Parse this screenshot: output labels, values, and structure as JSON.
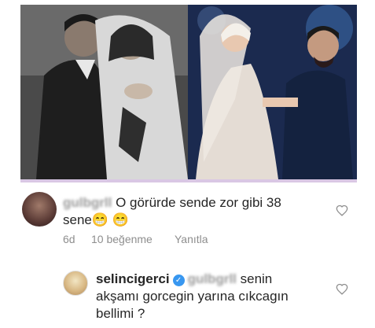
{
  "comment1": {
    "username": "gulbgrll",
    "text_line1": "O görürde sende zor gibi  38",
    "text_line2_prefix": "sene",
    "emoji1": "😁",
    "emoji2": "😁",
    "age": "6d",
    "likes": "10 beğenme",
    "reply": "Yanıtla"
  },
  "comment2": {
    "username": "selincigerci",
    "mention": "gulbgrll",
    "text_line1_suffix": "senin",
    "text_line2": "akşamı gorcegin yarına cıkcagın",
    "text_line3": "bellimi ?"
  },
  "icons": {
    "heart1": "heart-outline",
    "heart2": "heart-outline",
    "verified": "verified-badge"
  },
  "colors": {
    "divider": "#d9c7e4",
    "verified": "#3897f0",
    "meta_text": "#8e8e8e"
  }
}
